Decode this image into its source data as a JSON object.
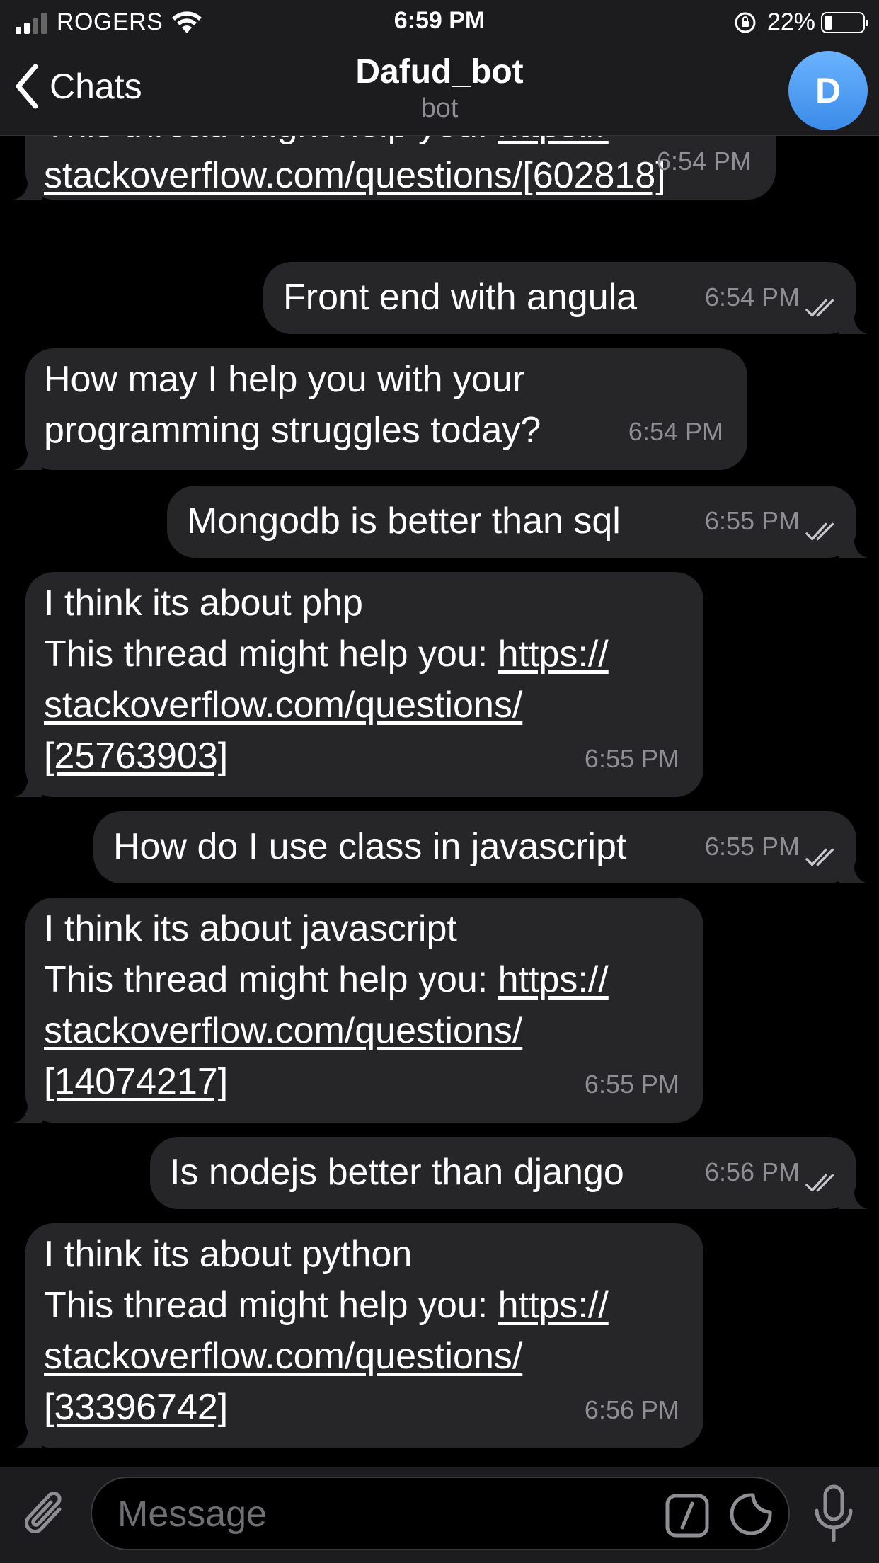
{
  "status_bar": {
    "carrier": "ROGERS",
    "time": "6:59 PM",
    "battery": "22%",
    "battery_level": 0.22
  },
  "header": {
    "back_label": "Chats",
    "title": "Dafud_bot",
    "subtitle": "bot",
    "avatar_initial": "D"
  },
  "messages": [
    {
      "dir": "in",
      "lines": [
        "This thread might help you: https://",
        "stackoverflow.com/questions/[602818]"
      ],
      "time": "6:54 PM"
    },
    {
      "dir": "out",
      "text": "Front end with angula",
      "time": "6:54 PM"
    },
    {
      "dir": "in",
      "lines": [
        "How may I help you with your",
        "programming struggles today?"
      ],
      "time": "6:54 PM"
    },
    {
      "dir": "out",
      "text": "Mongodb is better than sql",
      "time": "6:55 PM"
    },
    {
      "dir": "in",
      "lines": [
        "I think its about php",
        "This thread might help you: https://",
        "stackoverflow.com/questions/",
        "[25763903]"
      ],
      "time": "6:55 PM"
    },
    {
      "dir": "out",
      "text": "How do I use class in javascript",
      "time": "6:55 PM"
    },
    {
      "dir": "in",
      "lines": [
        "I think its about javascript",
        "This thread might help you: https://",
        "stackoverflow.com/questions/",
        "[14074217]"
      ],
      "time": "6:55 PM"
    },
    {
      "dir": "out",
      "text": "Is nodejs better than django",
      "time": "6:56 PM"
    },
    {
      "dir": "in",
      "lines": [
        "I think its about python",
        "This thread might help you: https://",
        "stackoverflow.com/questions/",
        "[33396742]"
      ],
      "time": "6:56 PM"
    }
  ],
  "input": {
    "placeholder": "Message"
  }
}
